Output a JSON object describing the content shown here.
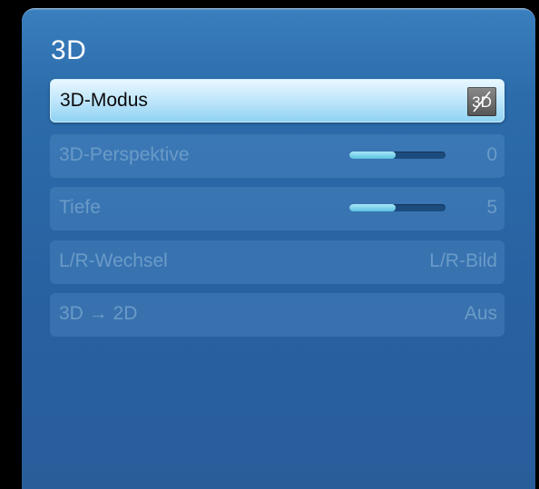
{
  "menu": {
    "title": "3D",
    "items": [
      {
        "label": "3D-Modus",
        "icon": "3d-mode-icon",
        "icon_text": "3D",
        "selected": true
      },
      {
        "label": "3D-Perspektive",
        "value": "0",
        "slider_level": 0.48
      },
      {
        "label": "Tiefe",
        "value": "5",
        "slider_level": 0.48
      },
      {
        "label": "L/R-Wechsel",
        "value": "L/R-Bild"
      },
      {
        "label": "3D → 2D",
        "value": "Aus"
      }
    ]
  },
  "colors": {
    "panel": "#2c6cab",
    "selected_row": "#bfe6fb",
    "disabled_text": "#6a9bc8",
    "slider_fill": "#5cc2e2",
    "slider_track": "#1c4b7e"
  }
}
